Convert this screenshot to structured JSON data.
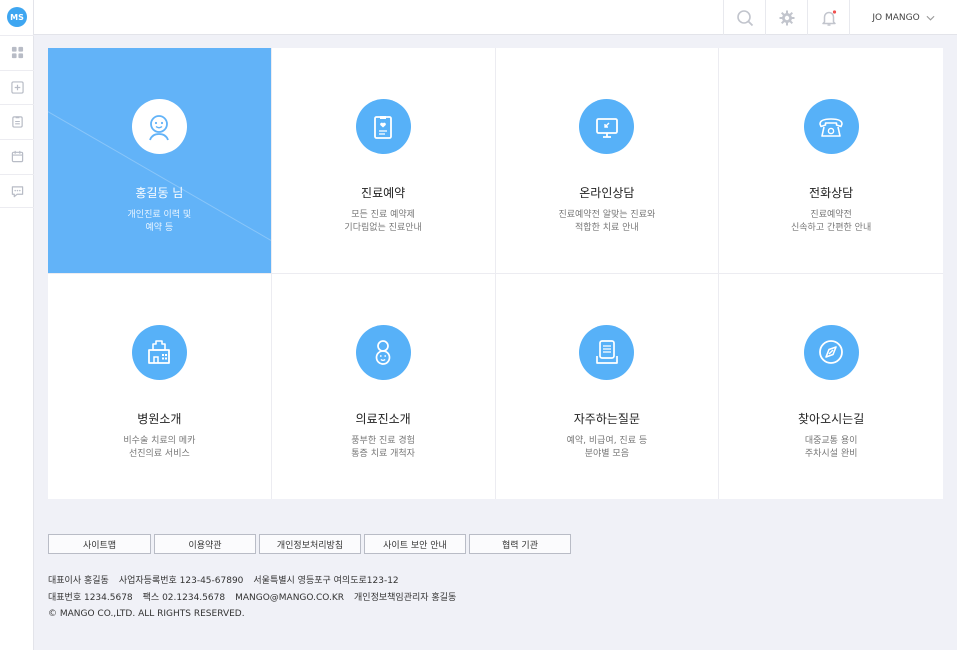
{
  "rail": {
    "logo_text": "MS",
    "icons": [
      "grid-icon",
      "plus-box-icon",
      "clipboard-icon",
      "calendar-icon",
      "chat-icon"
    ]
  },
  "topbar": {
    "icons": [
      "search-icon",
      "gear-icon",
      "bell-icon"
    ],
    "user_name": "JO MANGO",
    "accent_color": "#62b3f8"
  },
  "tiles": [
    {
      "title": "홍길동 님",
      "desc1": "개인진료 이력 및",
      "desc2": "예약 등",
      "icon": "person-icon",
      "active": true
    },
    {
      "title": "진료예약",
      "desc1": "모든 진료 예약제",
      "desc2": "기다림없는 진료안내",
      "icon": "clipboard-heart-icon"
    },
    {
      "title": "온라인상담",
      "desc1": "진료예약전 알맞는 진료와",
      "desc2": "적합한 치료 안내",
      "icon": "monitor-icon"
    },
    {
      "title": "전화상담",
      "desc1": "진료예약전",
      "desc2": "신속하고 간편한 안내",
      "icon": "telephone-icon"
    },
    {
      "title": "병원소개",
      "desc1": "비수술 치료의 메카",
      "desc2": "선진의료 서비스",
      "icon": "hospital-icon"
    },
    {
      "title": "의료진소개",
      "desc1": "풍부한 진료 경험",
      "desc2": "통증 치료 개척자",
      "icon": "doctor-icon"
    },
    {
      "title": "자주하는질문",
      "desc1": "예약, 비급여, 진료 등",
      "desc2": "분야별 모음",
      "icon": "document-icon"
    },
    {
      "title": "찾아오시는길",
      "desc1": "대중교통 용이",
      "desc2": "주차시설 완비",
      "icon": "compass-icon"
    }
  ],
  "footer": {
    "buttons": [
      "사이트맵",
      "이용약관",
      "개인정보처리방침",
      "사이트 보안 안내",
      "협력 기관"
    ],
    "line1": [
      "대표이사 홍길동",
      "사업자등록번호 123-45-67890",
      "서울특별시 영등포구 여의도로123-12"
    ],
    "line2": [
      "대표번호 1234.5678",
      "팩스 02.1234.5678",
      "MANGO@MANGO.CO.KR",
      "개인정보책임관리자 홍길동"
    ],
    "copyright": "© MANGO CO.,LTD. ALL RIGHTS RESERVED."
  }
}
